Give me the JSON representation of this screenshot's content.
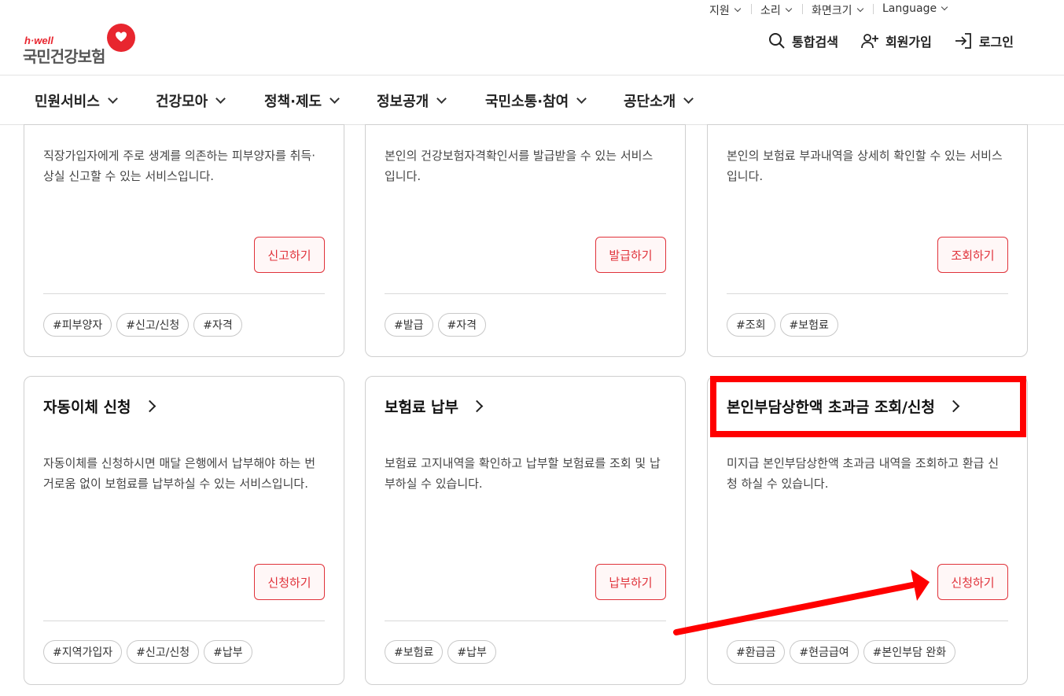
{
  "utility": {
    "support": "지원",
    "sound": "소리",
    "screen_size": "화면크기",
    "language": "Language"
  },
  "logo": {
    "brand": "h·well",
    "name": "국민건강보험"
  },
  "header": {
    "search": "통합검색",
    "signup": "회원가입",
    "login": "로그인"
  },
  "gnb": [
    "민원서비스",
    "건강모아",
    "정책·제도",
    "정보공개",
    "국민소통·참여",
    "공단소개"
  ],
  "cards_top": [
    {
      "desc": "직장가입자에게 주로 생계를 의존하는 피부양자를 취득·상실 신고할 수 있는 서비스입니다.",
      "action": "신고하기",
      "tags": [
        "#피부양자",
        "#신고/신청",
        "#자격"
      ]
    },
    {
      "desc": "본인의 건강보험자격확인서를 발급받을 수 있는 서비스 입니다.",
      "action": "발급하기",
      "tags": [
        "#발급",
        "#자격"
      ]
    },
    {
      "desc": "본인의 보험료 부과내역을 상세히 확인할 수 있는 서비스 입니다.",
      "action": "조회하기",
      "tags": [
        "#조회",
        "#보험료"
      ]
    }
  ],
  "cards_bottom": [
    {
      "title": "자동이체 신청",
      "desc": "자동이체를 신청하시면 매달 은행에서 납부해야 하는 번거로움 없이 보험료를 납부하실 수 있는 서비스입니다.",
      "action": "신청하기",
      "tags": [
        "#지역가입자",
        "#신고/신청",
        "#납부"
      ]
    },
    {
      "title": "보험료 납부",
      "desc": "보험료 고지내역을 확인하고 납부할 보험료를 조회 및 납부하실 수 있습니다.",
      "action": "납부하기",
      "tags": [
        "#보험료",
        "#납부"
      ]
    },
    {
      "title": "본인부담상한액 초과금 조회/신청",
      "desc": "미지급 본인부담상한액 초과금 내역을 조회하고 환급 신청 하실 수 있습니다.",
      "action": "신청하기",
      "tags": [
        "#환급금",
        "#현금급여",
        "#본인부담 완화"
      ]
    }
  ],
  "colors": {
    "accent": "#e0323a",
    "annotation": "#ff0000"
  }
}
